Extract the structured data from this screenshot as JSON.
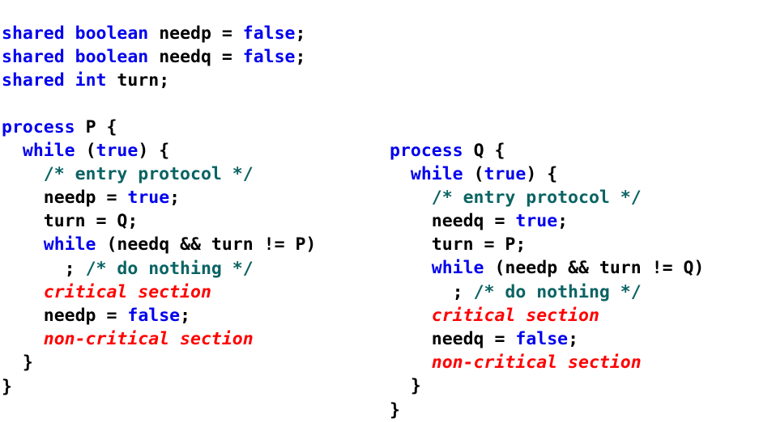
{
  "document": {
    "title": "Peterson's mutual exclusion algorithm",
    "language": "pseudocode-c",
    "background_color": "#ffffff"
  },
  "colors": {
    "keyword": "#0000ee",
    "literal": "#0000ee",
    "identifier": "#000000",
    "punctuation": "#000000",
    "operator": "#000000",
    "comment": "#0b6363",
    "placeholder": "#ff0000"
  },
  "blocks": {
    "shared": {
      "name": "shared-declarations",
      "lines": [
        {
          "id": "shared-needp",
          "text": "shared boolean needp = false;",
          "tokens": [
            {
              "t": "shared",
              "k": "kw"
            },
            {
              "t": " ",
              "k": "punc"
            },
            {
              "t": "boolean",
              "k": "kw"
            },
            {
              "t": " ",
              "k": "punc"
            },
            {
              "t": "needp",
              "k": "ident"
            },
            {
              "t": " ",
              "k": "punc"
            },
            {
              "t": "=",
              "k": "op"
            },
            {
              "t": " ",
              "k": "punc"
            },
            {
              "t": "false",
              "k": "lit"
            },
            {
              "t": ";",
              "k": "punc"
            }
          ]
        },
        {
          "id": "shared-needq",
          "text": "shared boolean needq = false;",
          "tokens": [
            {
              "t": "shared",
              "k": "kw"
            },
            {
              "t": " ",
              "k": "punc"
            },
            {
              "t": "boolean",
              "k": "kw"
            },
            {
              "t": " ",
              "k": "punc"
            },
            {
              "t": "needq",
              "k": "ident"
            },
            {
              "t": " ",
              "k": "punc"
            },
            {
              "t": "=",
              "k": "op"
            },
            {
              "t": " ",
              "k": "punc"
            },
            {
              "t": "false",
              "k": "lit"
            },
            {
              "t": ";",
              "k": "punc"
            }
          ]
        },
        {
          "id": "shared-turn",
          "text": "shared int turn;",
          "tokens": [
            {
              "t": "shared",
              "k": "kw"
            },
            {
              "t": " ",
              "k": "punc"
            },
            {
              "t": "int",
              "k": "kw"
            },
            {
              "t": " ",
              "k": "punc"
            },
            {
              "t": "turn",
              "k": "ident"
            },
            {
              "t": ";",
              "k": "punc"
            }
          ]
        }
      ]
    },
    "process_p": {
      "name": "process-p",
      "process_label": "P",
      "lines": [
        {
          "id": "p-header",
          "text": "process P {",
          "tokens": [
            {
              "t": "process",
              "k": "kw"
            },
            {
              "t": " ",
              "k": "punc"
            },
            {
              "t": "P",
              "k": "ident"
            },
            {
              "t": " ",
              "k": "punc"
            },
            {
              "t": "{",
              "k": "punc"
            }
          ]
        },
        {
          "id": "p-while-true",
          "text": "  while (true) {",
          "tokens": [
            {
              "t": "  ",
              "k": "punc"
            },
            {
              "t": "while",
              "k": "kw"
            },
            {
              "t": " ",
              "k": "punc"
            },
            {
              "t": "(",
              "k": "punc"
            },
            {
              "t": "true",
              "k": "lit"
            },
            {
              "t": ")",
              "k": "punc"
            },
            {
              "t": " ",
              "k": "punc"
            },
            {
              "t": "{",
              "k": "punc"
            }
          ]
        },
        {
          "id": "p-comment-entry",
          "text": "    /* entry protocol */",
          "tokens": [
            {
              "t": "    ",
              "k": "punc"
            },
            {
              "t": "/* entry protocol */",
              "k": "comment"
            }
          ]
        },
        {
          "id": "p-set-needp-true",
          "text": "    needp = true;",
          "tokens": [
            {
              "t": "    ",
              "k": "punc"
            },
            {
              "t": "needp",
              "k": "ident"
            },
            {
              "t": " ",
              "k": "punc"
            },
            {
              "t": "=",
              "k": "op"
            },
            {
              "t": " ",
              "k": "punc"
            },
            {
              "t": "true",
              "k": "lit"
            },
            {
              "t": ";",
              "k": "punc"
            }
          ]
        },
        {
          "id": "p-set-turn-q",
          "text": "    turn = Q;",
          "tokens": [
            {
              "t": "    ",
              "k": "punc"
            },
            {
              "t": "turn",
              "k": "ident"
            },
            {
              "t": " ",
              "k": "punc"
            },
            {
              "t": "=",
              "k": "op"
            },
            {
              "t": " ",
              "k": "punc"
            },
            {
              "t": "Q",
              "k": "ident"
            },
            {
              "t": ";",
              "k": "punc"
            }
          ]
        },
        {
          "id": "p-spin-while",
          "text": "    while (needq && turn != P)",
          "tokens": [
            {
              "t": "    ",
              "k": "punc"
            },
            {
              "t": "while",
              "k": "kw"
            },
            {
              "t": " ",
              "k": "punc"
            },
            {
              "t": "(needq && turn != P)",
              "k": "ident"
            }
          ]
        },
        {
          "id": "p-do-nothing",
          "text": "      ; /* do nothing */",
          "tokens": [
            {
              "t": "      ; ",
              "k": "punc"
            },
            {
              "t": "/* do nothing */",
              "k": "comment"
            }
          ]
        },
        {
          "id": "p-critical-section",
          "text": "    critical section",
          "tokens": [
            {
              "t": "    ",
              "k": "punc"
            },
            {
              "t": "critical section",
              "k": "placeholder"
            }
          ]
        },
        {
          "id": "p-set-needp-false",
          "text": "    needp = false;",
          "tokens": [
            {
              "t": "    ",
              "k": "punc"
            },
            {
              "t": "needp",
              "k": "ident"
            },
            {
              "t": " ",
              "k": "punc"
            },
            {
              "t": "=",
              "k": "op"
            },
            {
              "t": " ",
              "k": "punc"
            },
            {
              "t": "false",
              "k": "lit"
            },
            {
              "t": ";",
              "k": "punc"
            }
          ]
        },
        {
          "id": "p-non-critical-section",
          "text": "    non-critical section",
          "tokens": [
            {
              "t": "    ",
              "k": "punc"
            },
            {
              "t": "non-critical section",
              "k": "placeholder"
            }
          ]
        },
        {
          "id": "p-close-while",
          "text": "  }",
          "tokens": [
            {
              "t": "  ",
              "k": "punc"
            },
            {
              "t": "}",
              "k": "punc"
            }
          ]
        },
        {
          "id": "p-close-process",
          "text": "}",
          "tokens": [
            {
              "t": "}",
              "k": "punc"
            }
          ]
        }
      ]
    },
    "process_q": {
      "name": "process-q",
      "process_label": "Q",
      "lines": [
        {
          "id": "q-header",
          "text": "process Q {",
          "tokens": [
            {
              "t": "process",
              "k": "kw"
            },
            {
              "t": " ",
              "k": "punc"
            },
            {
              "t": "Q",
              "k": "ident"
            },
            {
              "t": " ",
              "k": "punc"
            },
            {
              "t": "{",
              "k": "punc"
            }
          ]
        },
        {
          "id": "q-while-true",
          "text": "  while (true) {",
          "tokens": [
            {
              "t": "  ",
              "k": "punc"
            },
            {
              "t": "while",
              "k": "kw"
            },
            {
              "t": " ",
              "k": "punc"
            },
            {
              "t": "(",
              "k": "punc"
            },
            {
              "t": "true",
              "k": "lit"
            },
            {
              "t": ")",
              "k": "punc"
            },
            {
              "t": " ",
              "k": "punc"
            },
            {
              "t": "{",
              "k": "punc"
            }
          ]
        },
        {
          "id": "q-comment-entry",
          "text": "    /* entry protocol */",
          "tokens": [
            {
              "t": "    ",
              "k": "punc"
            },
            {
              "t": "/* entry protocol */",
              "k": "comment"
            }
          ]
        },
        {
          "id": "q-set-needq-true",
          "text": "    needq = true;",
          "tokens": [
            {
              "t": "    ",
              "k": "punc"
            },
            {
              "t": "needq",
              "k": "ident"
            },
            {
              "t": " ",
              "k": "punc"
            },
            {
              "t": "=",
              "k": "op"
            },
            {
              "t": " ",
              "k": "punc"
            },
            {
              "t": "true",
              "k": "lit"
            },
            {
              "t": ";",
              "k": "punc"
            }
          ]
        },
        {
          "id": "q-set-turn-p",
          "text": "    turn = P;",
          "tokens": [
            {
              "t": "    ",
              "k": "punc"
            },
            {
              "t": "turn",
              "k": "ident"
            },
            {
              "t": " ",
              "k": "punc"
            },
            {
              "t": "=",
              "k": "op"
            },
            {
              "t": " ",
              "k": "punc"
            },
            {
              "t": "P",
              "k": "ident"
            },
            {
              "t": ";",
              "k": "punc"
            }
          ]
        },
        {
          "id": "q-spin-while",
          "text": "    while (needp && turn != Q)",
          "tokens": [
            {
              "t": "    ",
              "k": "punc"
            },
            {
              "t": "while",
              "k": "kw"
            },
            {
              "t": " ",
              "k": "punc"
            },
            {
              "t": "(needp && turn != Q)",
              "k": "ident"
            }
          ]
        },
        {
          "id": "q-do-nothing",
          "text": "      ; /* do nothing */",
          "tokens": [
            {
              "t": "      ; ",
              "k": "punc"
            },
            {
              "t": "/* do nothing */",
              "k": "comment"
            }
          ]
        },
        {
          "id": "q-critical-section",
          "text": "    critical section",
          "tokens": [
            {
              "t": "    ",
              "k": "punc"
            },
            {
              "t": "critical section",
              "k": "placeholder"
            }
          ]
        },
        {
          "id": "q-set-needq-false",
          "text": "    needq = false;",
          "tokens": [
            {
              "t": "    ",
              "k": "punc"
            },
            {
              "t": "needq",
              "k": "ident"
            },
            {
              "t": " ",
              "k": "punc"
            },
            {
              "t": "=",
              "k": "op"
            },
            {
              "t": " ",
              "k": "punc"
            },
            {
              "t": "false",
              "k": "lit"
            },
            {
              "t": ";",
              "k": "punc"
            }
          ]
        },
        {
          "id": "q-non-critical-section",
          "text": "    non-critical section",
          "tokens": [
            {
              "t": "    ",
              "k": "punc"
            },
            {
              "t": "non-critical section",
              "k": "placeholder"
            }
          ]
        },
        {
          "id": "q-close-while",
          "text": "  }",
          "tokens": [
            {
              "t": "  ",
              "k": "punc"
            },
            {
              "t": "}",
              "k": "punc"
            }
          ]
        },
        {
          "id": "q-close-process",
          "text": "}",
          "tokens": [
            {
              "t": "}",
              "k": "punc"
            }
          ]
        }
      ]
    }
  }
}
